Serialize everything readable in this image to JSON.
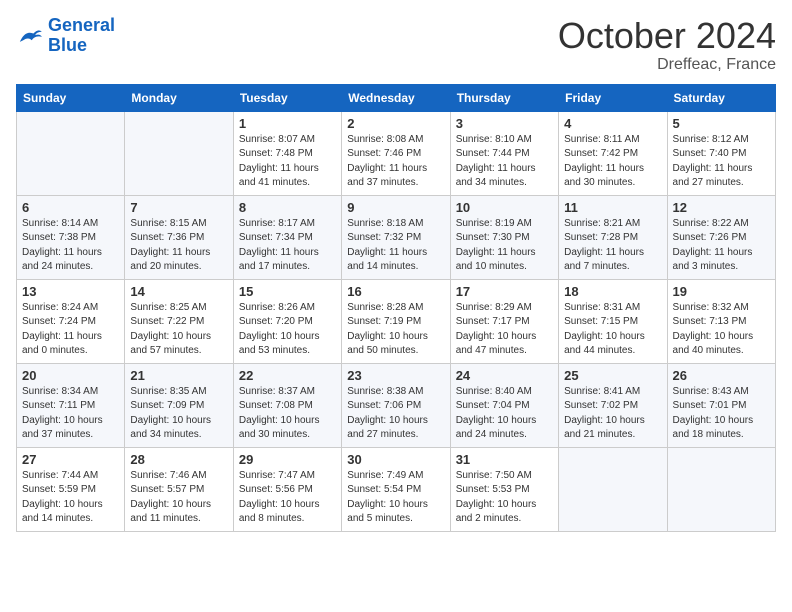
{
  "header": {
    "logo_line1": "General",
    "logo_line2": "Blue",
    "month": "October 2024",
    "location": "Dreffeac, France"
  },
  "weekdays": [
    "Sunday",
    "Monday",
    "Tuesday",
    "Wednesday",
    "Thursday",
    "Friday",
    "Saturday"
  ],
  "weeks": [
    [
      {
        "day": "",
        "info": ""
      },
      {
        "day": "",
        "info": ""
      },
      {
        "day": "1",
        "info": "Sunrise: 8:07 AM\nSunset: 7:48 PM\nDaylight: 11 hours and 41 minutes."
      },
      {
        "day": "2",
        "info": "Sunrise: 8:08 AM\nSunset: 7:46 PM\nDaylight: 11 hours and 37 minutes."
      },
      {
        "day": "3",
        "info": "Sunrise: 8:10 AM\nSunset: 7:44 PM\nDaylight: 11 hours and 34 minutes."
      },
      {
        "day": "4",
        "info": "Sunrise: 8:11 AM\nSunset: 7:42 PM\nDaylight: 11 hours and 30 minutes."
      },
      {
        "day": "5",
        "info": "Sunrise: 8:12 AM\nSunset: 7:40 PM\nDaylight: 11 hours and 27 minutes."
      }
    ],
    [
      {
        "day": "6",
        "info": "Sunrise: 8:14 AM\nSunset: 7:38 PM\nDaylight: 11 hours and 24 minutes."
      },
      {
        "day": "7",
        "info": "Sunrise: 8:15 AM\nSunset: 7:36 PM\nDaylight: 11 hours and 20 minutes."
      },
      {
        "day": "8",
        "info": "Sunrise: 8:17 AM\nSunset: 7:34 PM\nDaylight: 11 hours and 17 minutes."
      },
      {
        "day": "9",
        "info": "Sunrise: 8:18 AM\nSunset: 7:32 PM\nDaylight: 11 hours and 14 minutes."
      },
      {
        "day": "10",
        "info": "Sunrise: 8:19 AM\nSunset: 7:30 PM\nDaylight: 11 hours and 10 minutes."
      },
      {
        "day": "11",
        "info": "Sunrise: 8:21 AM\nSunset: 7:28 PM\nDaylight: 11 hours and 7 minutes."
      },
      {
        "day": "12",
        "info": "Sunrise: 8:22 AM\nSunset: 7:26 PM\nDaylight: 11 hours and 3 minutes."
      }
    ],
    [
      {
        "day": "13",
        "info": "Sunrise: 8:24 AM\nSunset: 7:24 PM\nDaylight: 11 hours and 0 minutes."
      },
      {
        "day": "14",
        "info": "Sunrise: 8:25 AM\nSunset: 7:22 PM\nDaylight: 10 hours and 57 minutes."
      },
      {
        "day": "15",
        "info": "Sunrise: 8:26 AM\nSunset: 7:20 PM\nDaylight: 10 hours and 53 minutes."
      },
      {
        "day": "16",
        "info": "Sunrise: 8:28 AM\nSunset: 7:19 PM\nDaylight: 10 hours and 50 minutes."
      },
      {
        "day": "17",
        "info": "Sunrise: 8:29 AM\nSunset: 7:17 PM\nDaylight: 10 hours and 47 minutes."
      },
      {
        "day": "18",
        "info": "Sunrise: 8:31 AM\nSunset: 7:15 PM\nDaylight: 10 hours and 44 minutes."
      },
      {
        "day": "19",
        "info": "Sunrise: 8:32 AM\nSunset: 7:13 PM\nDaylight: 10 hours and 40 minutes."
      }
    ],
    [
      {
        "day": "20",
        "info": "Sunrise: 8:34 AM\nSunset: 7:11 PM\nDaylight: 10 hours and 37 minutes."
      },
      {
        "day": "21",
        "info": "Sunrise: 8:35 AM\nSunset: 7:09 PM\nDaylight: 10 hours and 34 minutes."
      },
      {
        "day": "22",
        "info": "Sunrise: 8:37 AM\nSunset: 7:08 PM\nDaylight: 10 hours and 30 minutes."
      },
      {
        "day": "23",
        "info": "Sunrise: 8:38 AM\nSunset: 7:06 PM\nDaylight: 10 hours and 27 minutes."
      },
      {
        "day": "24",
        "info": "Sunrise: 8:40 AM\nSunset: 7:04 PM\nDaylight: 10 hours and 24 minutes."
      },
      {
        "day": "25",
        "info": "Sunrise: 8:41 AM\nSunset: 7:02 PM\nDaylight: 10 hours and 21 minutes."
      },
      {
        "day": "26",
        "info": "Sunrise: 8:43 AM\nSunset: 7:01 PM\nDaylight: 10 hours and 18 minutes."
      }
    ],
    [
      {
        "day": "27",
        "info": "Sunrise: 7:44 AM\nSunset: 5:59 PM\nDaylight: 10 hours and 14 minutes."
      },
      {
        "day": "28",
        "info": "Sunrise: 7:46 AM\nSunset: 5:57 PM\nDaylight: 10 hours and 11 minutes."
      },
      {
        "day": "29",
        "info": "Sunrise: 7:47 AM\nSunset: 5:56 PM\nDaylight: 10 hours and 8 minutes."
      },
      {
        "day": "30",
        "info": "Sunrise: 7:49 AM\nSunset: 5:54 PM\nDaylight: 10 hours and 5 minutes."
      },
      {
        "day": "31",
        "info": "Sunrise: 7:50 AM\nSunset: 5:53 PM\nDaylight: 10 hours and 2 minutes."
      },
      {
        "day": "",
        "info": ""
      },
      {
        "day": "",
        "info": ""
      }
    ]
  ]
}
